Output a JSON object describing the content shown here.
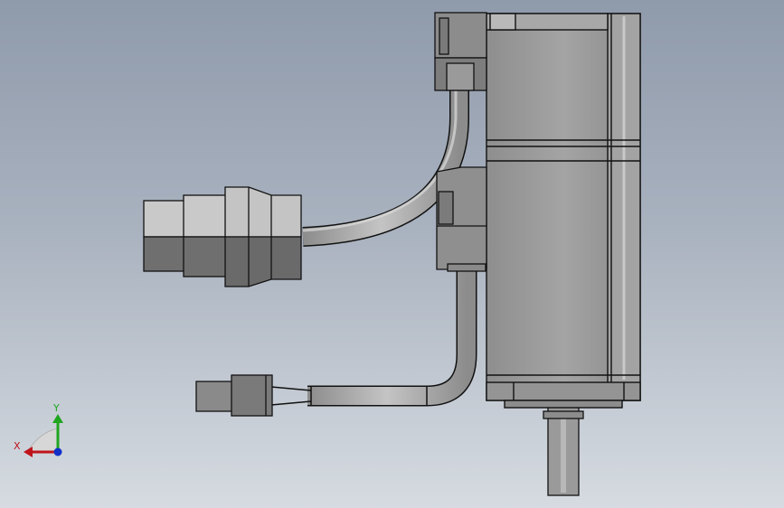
{
  "view": {
    "background_top": "#8f9aab",
    "background_bottom": "#d6dbe1"
  },
  "axes": {
    "x_label": "X",
    "y_label": "Y",
    "x_color": "#c0141c",
    "y_color": "#1fa51f",
    "z_color": "#1030c8"
  },
  "colors": {
    "body_light": "#c9c9c9",
    "body_mid": "#9e9e9e",
    "body_dark": "#6e6e6e",
    "edge": "#111111"
  }
}
